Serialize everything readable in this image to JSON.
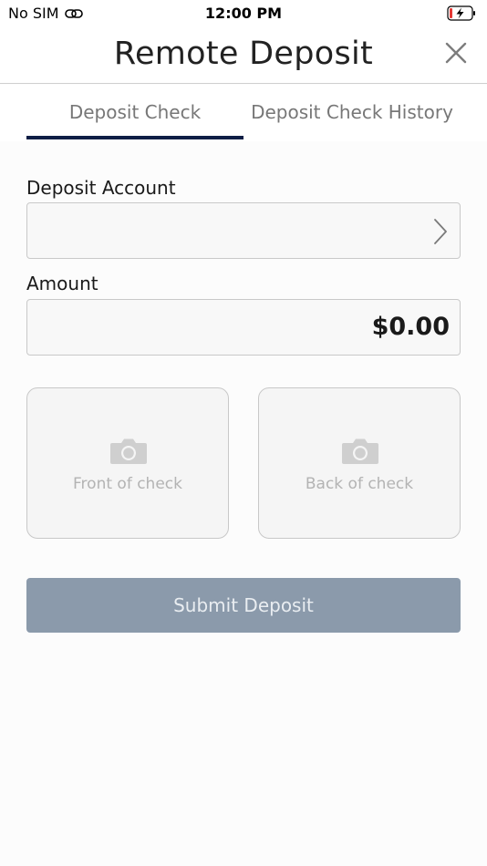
{
  "status_bar": {
    "carrier": "No SIM",
    "time": "12:00 PM"
  },
  "header": {
    "title": "Remote Deposit",
    "close_icon": "close-icon"
  },
  "tabs": [
    {
      "label": "Deposit Check",
      "active": true
    },
    {
      "label": "Deposit Check History",
      "active": false
    }
  ],
  "form": {
    "deposit_account": {
      "label": "Deposit Account",
      "value": ""
    },
    "amount": {
      "label": "Amount",
      "value": "$0.00"
    }
  },
  "check_images": {
    "front_label": "Front of check",
    "back_label": "Back of check",
    "icon": "camera-icon"
  },
  "submit": {
    "label": "Submit Deposit"
  },
  "colors": {
    "tab_indicator": "#0f1e45",
    "submit_disabled": "#8b9aab"
  }
}
